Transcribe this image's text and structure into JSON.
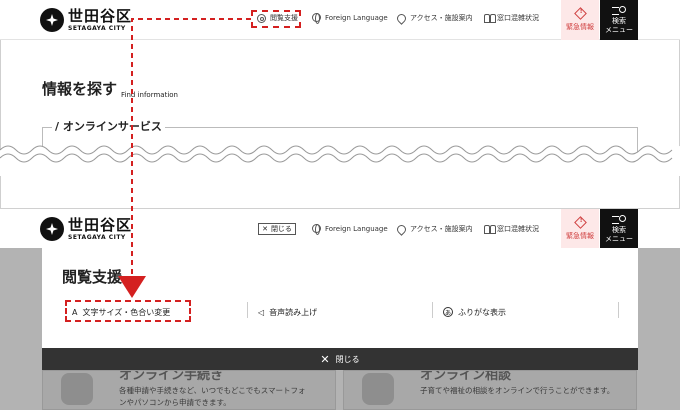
{
  "header": {
    "logo_jp": "世田谷区",
    "logo_en": "SETAGAYA CITY",
    "nav": {
      "accessibility": "閲覧支援",
      "foreign_language": "Foreign Language",
      "access": "アクセス・施設案内",
      "congestion": "窓口混雑状況"
    },
    "emergency": "緊急情報",
    "search_menu_line1": "検索",
    "search_menu_line2": "メニュー",
    "close_label": "閉じる"
  },
  "page": {
    "title_jp": "情報を探す",
    "title_en": "Find information",
    "online_services_label": "/ オンラインサービス"
  },
  "panel": {
    "title": "閲覧支援",
    "options": [
      {
        "icon": "text-size-icon",
        "label": "文字サイズ・色合い変更"
      },
      {
        "icon": "speaker-icon",
        "label": "音声読み上げ"
      },
      {
        "icon": "furigana-icon",
        "label": "ふりがな表示"
      }
    ],
    "close_bar": "閉じる"
  },
  "cards": [
    {
      "title": "オンライン手続き",
      "desc": "各種申請や手続きなど、いつでもどこでもスマートフォンやパソコンから申請できます。"
    },
    {
      "title": "オンライン相談",
      "desc": "子育てや福祉の相談をオンラインで行うことができます。"
    }
  ],
  "colors": {
    "emergency_bg": "#fde8e8",
    "emergency_text": "#d04040",
    "menu_bg": "#111111",
    "annotation": "#d42020",
    "overlay": "#b3b3b3",
    "close_bar": "#333333"
  }
}
